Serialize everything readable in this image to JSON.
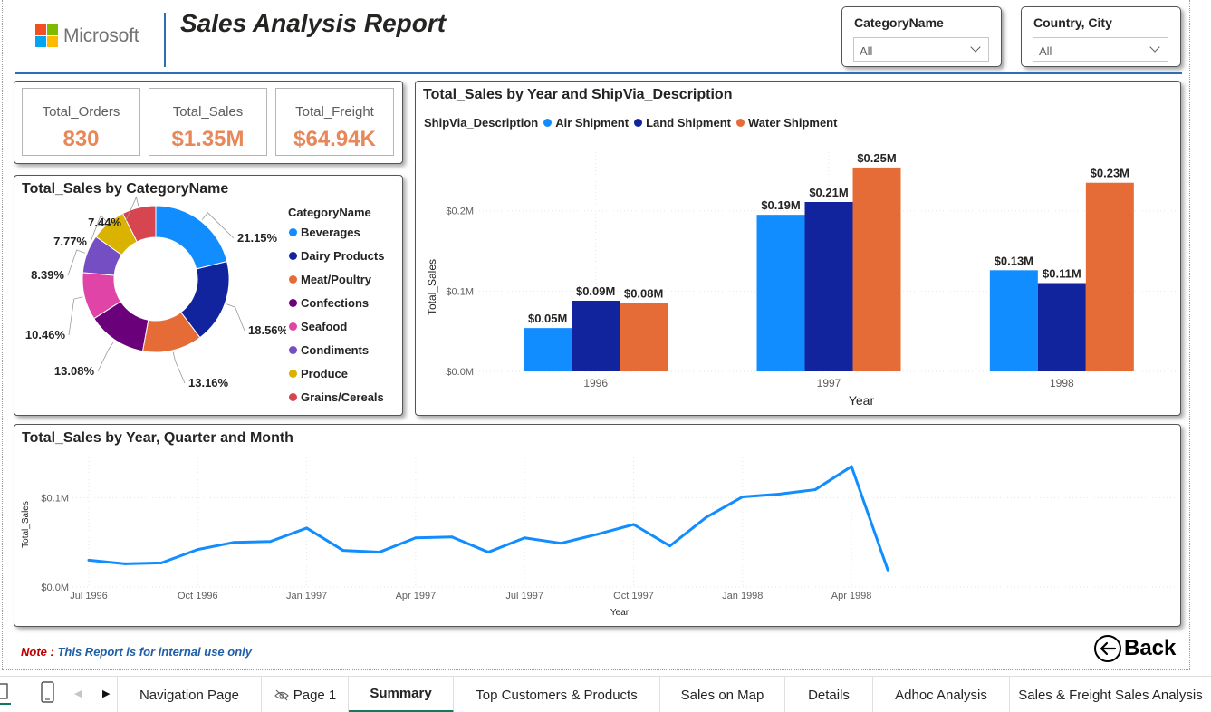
{
  "header": {
    "logo_text": "Microsoft",
    "title": "Sales Analysis Report"
  },
  "slicers": [
    {
      "label": "CategoryName",
      "value": "All"
    },
    {
      "label": "Country, City",
      "value": "All"
    }
  ],
  "cards": [
    {
      "label": "Total_Orders",
      "value": "830"
    },
    {
      "label": "Total_Sales",
      "value": "$1.35M"
    },
    {
      "label": "Total_Freight",
      "value": "$64.94K"
    }
  ],
  "colors": {
    "accent_blue": "#2c6fb6",
    "card_value": "#e8885a",
    "note_red": "#c00000",
    "note_blue": "#1f5fa8",
    "tab_underline": "#117865"
  },
  "chart_data": [
    {
      "type": "pie",
      "variant": "donut",
      "title": "Total_Sales by CategoryName",
      "legend_title": "CategoryName",
      "legend_position": "right",
      "categories": [
        "Beverages",
        "Dairy Products",
        "Meat/Poultry",
        "Confections",
        "Seafood",
        "Condiments",
        "Produce",
        "Grains/Cereals"
      ],
      "values": [
        21.15,
        18.56,
        13.16,
        13.08,
        10.46,
        8.39,
        7.77,
        7.44
      ],
      "labels": [
        "21.15%",
        "18.56%",
        "13.16%",
        "13.08%",
        "10.46%",
        "8.39%",
        "7.77%",
        "7.44%"
      ],
      "colors": [
        "#118dff",
        "#12239e",
        "#e66c37",
        "#6b007b",
        "#e044a7",
        "#744ec2",
        "#d9b300",
        "#d64550"
      ]
    },
    {
      "type": "bar",
      "title": "Total_Sales by Year and ShipVia_Description",
      "legend_title": "ShipVia_Description",
      "legend_position": "top-left",
      "xlabel": "Year",
      "ylabel": "Total_Sales",
      "categories": [
        "1996",
        "1997",
        "1998"
      ],
      "ylim": [
        0,
        0.255
      ],
      "yticks": [
        0,
        0.1,
        0.2
      ],
      "ytick_labels": [
        "$0.0M",
        "$0.1M",
        "$0.2M"
      ],
      "series": [
        {
          "name": "Air Shipment",
          "color": "#118dff",
          "values": [
            0.054,
            0.195,
            0.126
          ],
          "labels": [
            "$0.05M",
            "$0.19M",
            "$0.13M"
          ]
        },
        {
          "name": "Land Shipment",
          "color": "#12239e",
          "values": [
            0.088,
            0.211,
            0.11
          ],
          "labels": [
            "$0.09M",
            "$0.21M",
            "$0.11M"
          ]
        },
        {
          "name": "Water Shipment",
          "color": "#e66c37",
          "values": [
            0.085,
            0.254,
            0.235
          ],
          "labels": [
            "$0.08M",
            "$0.25M",
            "$0.23M"
          ]
        }
      ]
    },
    {
      "type": "line",
      "title": "Total_Sales by Year, Quarter and Month",
      "xlabel": "Year",
      "ylabel": "Total_Sales",
      "x": [
        "Jul 1996",
        "Aug 1996",
        "Sep 1996",
        "Oct 1996",
        "Nov 1996",
        "Dec 1996",
        "Jan 1997",
        "Feb 1997",
        "Mar 1997",
        "Apr 1997",
        "May 1997",
        "Jun 1997",
        "Jul 1997",
        "Aug 1997",
        "Sep 1997",
        "Oct 1997",
        "Nov 1997",
        "Dec 1997",
        "Jan 1998",
        "Feb 1998",
        "Mar 1998",
        "Apr 1998",
        "May 1998"
      ],
      "xtick_labels": [
        "Jul 1996",
        "Oct 1996",
        "Jan 1997",
        "Apr 1997",
        "Jul 1997",
        "Oct 1997",
        "Jan 1998",
        "Apr 1998"
      ],
      "ylim": [
        0,
        0.14
      ],
      "yticks": [
        0,
        0.1
      ],
      "ytick_labels": [
        "$0.0M",
        "$0.1M"
      ],
      "color": "#118dff",
      "series": [
        {
          "values": [
            0.03,
            0.026,
            0.027,
            0.042,
            0.05,
            0.051,
            0.066,
            0.041,
            0.039,
            0.055,
            0.056,
            0.039,
            0.055,
            0.049,
            0.059,
            0.07,
            0.046,
            0.078,
            0.101,
            0.104,
            0.109,
            0.135,
            0.019
          ]
        }
      ]
    }
  ],
  "footer": {
    "note_label": "Note :",
    "note_text": "This Report is for internal use only",
    "back_label": "Back"
  },
  "tabs": {
    "items": [
      "Navigation Page",
      "Page 1",
      "Summary",
      "Top Customers & Products",
      "Sales on Map",
      "Details",
      "Adhoc Analysis",
      "Sales & Freight Sales Analysis"
    ],
    "active": "Summary"
  }
}
